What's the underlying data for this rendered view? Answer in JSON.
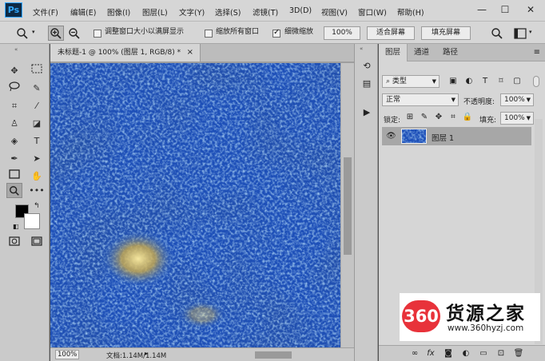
{
  "app": {
    "logo": "Ps"
  },
  "menu": [
    "文件(F)",
    "编辑(E)",
    "图像(I)",
    "图层(L)",
    "文字(Y)",
    "选择(S)",
    "滤镜(T)",
    "3D(D)",
    "视图(V)",
    "窗口(W)",
    "帮助(H)"
  ],
  "window_controls": {
    "minimize": "—",
    "maximize": "☐",
    "close": "✕"
  },
  "options": {
    "fit_window_label": "调整窗口大小以满屏显示",
    "zoom_all_label": "缩放所有窗口",
    "scrubby_label": "细微缩放",
    "scrubby_checked": true,
    "zoom_value": "100%",
    "fit_screen": "适合屏幕",
    "fill_screen": "填充屏幕"
  },
  "document": {
    "tab_title": "未标题-1 @ 100% (图层 1, RGB/8) *",
    "close": "×",
    "zoom": "100%",
    "doc_info": "文档:1.14M/1.14M"
  },
  "colors": {
    "foreground": "#000000",
    "background": "#ffffff",
    "canvas_base": "#1d4fb8"
  },
  "layers_panel": {
    "tabs": [
      "图层",
      "通道",
      "路径"
    ],
    "filter_kind": "类型",
    "blend_mode": "正常",
    "opacity_label": "不透明度:",
    "opacity_value": "100%",
    "lock_label": "锁定:",
    "fill_label": "填充:",
    "fill_value": "100%",
    "layers": [
      {
        "name": "图层 1",
        "visible": true
      }
    ],
    "footer_fx": "fx"
  },
  "watermark": {
    "logo": "360",
    "name": "货源之家",
    "url": "www.360hyzj.com"
  }
}
